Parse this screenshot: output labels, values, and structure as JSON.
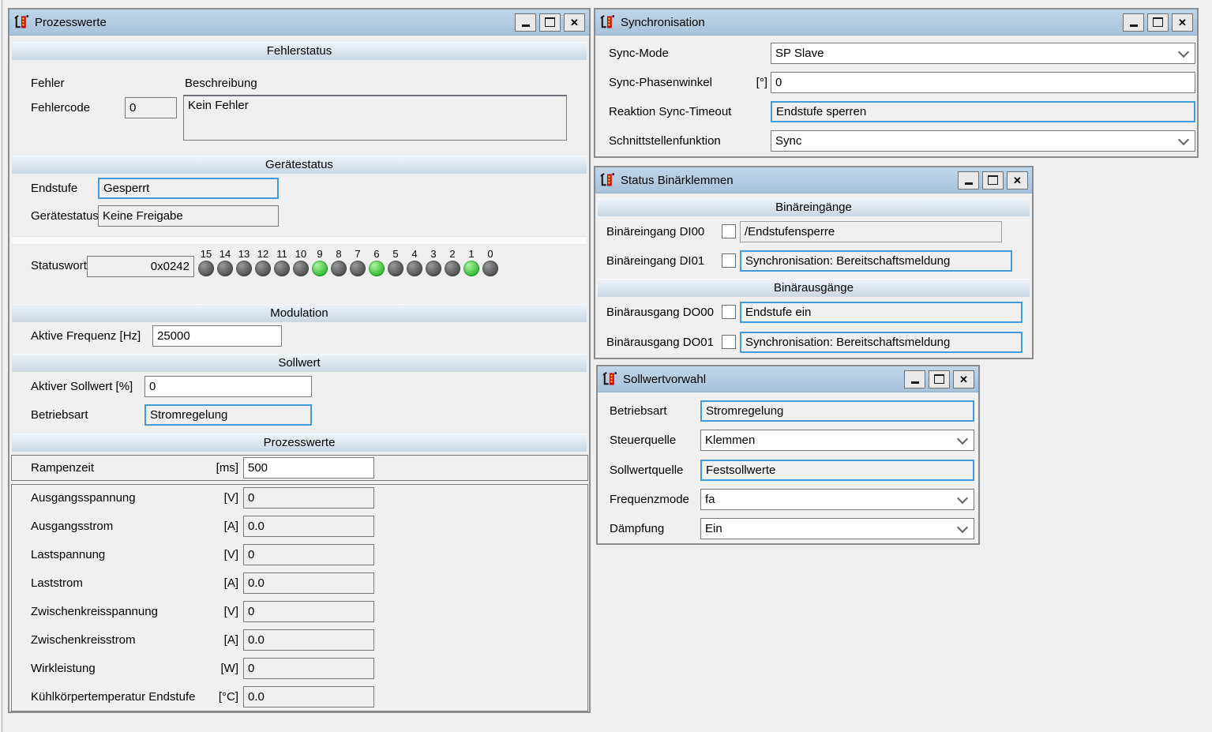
{
  "colors": {
    "titlebar_top": "#c0d6e9",
    "titlebar_bottom": "#a6c2da",
    "section_header_top": "#eef3f8",
    "section_header_bottom": "#c9d7e4",
    "field_border": "#7a7a7a",
    "accent_border": "#3f9bdc",
    "led_on": "#2fb52f",
    "led_off": "#4d4d4d",
    "window_bg": "#f0f0f0"
  },
  "prozesswerte": {
    "title": "Prozesswerte",
    "fehlerstatus": {
      "header": "Fehlerstatus",
      "fehler_label": "Fehler",
      "beschreibung_label": "Beschreibung",
      "fehlercode_label": "Fehlercode",
      "fehlercode_value": "0",
      "beschreibung_value": "Kein Fehler"
    },
    "geraetestatus": {
      "header": "Gerätestatus",
      "endstufe_label": "Endstufe",
      "endstufe_value": "Gesperrt",
      "status_label": "Gerätestatus",
      "status_value": "Keine Freigabe",
      "statuswort_label": "Statuswort",
      "statuswort_value": "0x0242",
      "led_bits": [
        {
          "bit": "15",
          "on": false
        },
        {
          "bit": "14",
          "on": false
        },
        {
          "bit": "13",
          "on": false
        },
        {
          "bit": "12",
          "on": false
        },
        {
          "bit": "11",
          "on": false
        },
        {
          "bit": "10",
          "on": false
        },
        {
          "bit": "9",
          "on": true
        },
        {
          "bit": "8",
          "on": false
        },
        {
          "bit": "7",
          "on": false
        },
        {
          "bit": "6",
          "on": true
        },
        {
          "bit": "5",
          "on": false
        },
        {
          "bit": "4",
          "on": false
        },
        {
          "bit": "3",
          "on": false
        },
        {
          "bit": "2",
          "on": false
        },
        {
          "bit": "1",
          "on": true
        },
        {
          "bit": "0",
          "on": false
        }
      ]
    },
    "modulation": {
      "header": "Modulation",
      "frequenz_label": "Aktive Frequenz  [Hz]",
      "frequenz_value": "25000"
    },
    "sollwert": {
      "header": "Sollwert",
      "aktiver_label": "Aktiver Sollwert [%]",
      "aktiver_value": "0",
      "betriebsart_label": "Betriebsart",
      "betriebsart_value": "Stromregelung"
    },
    "werte": {
      "header": "Prozesswerte",
      "rampenzeit": {
        "label": "Rampenzeit",
        "unit": "[ms]",
        "value": "500"
      },
      "rows": [
        {
          "label": "Ausgangsspannung",
          "unit": "[V]",
          "value": "0"
        },
        {
          "label": "Ausgangsstrom",
          "unit": "[A]",
          "value": "0.0"
        },
        {
          "label": "Lastspannung",
          "unit": "[V]",
          "value": "0"
        },
        {
          "label": "Laststrom",
          "unit": "[A]",
          "value": "0.0"
        },
        {
          "label": "Zwischenkreisspannung",
          "unit": "[V]",
          "value": "0"
        },
        {
          "label": "Zwischenkreisstrom",
          "unit": "[A]",
          "value": "0.0"
        },
        {
          "label": "Wirkleistung",
          "unit": "[W]",
          "value": "0"
        },
        {
          "label": "Kühlkörpertemperatur Endstufe",
          "unit": "[°C]",
          "value": "0.0"
        }
      ]
    }
  },
  "synchronisation": {
    "title": "Synchronisation",
    "sync_mode": {
      "label": "Sync-Mode",
      "value": "SP Slave"
    },
    "phasenwinkel": {
      "label": "Sync-Phasenwinkel",
      "unit": "[°]",
      "value": "0"
    },
    "timeout": {
      "label": "Reaktion Sync-Timeout",
      "value": "Endstufe sperren"
    },
    "schnittstelle": {
      "label": "Schnittstellenfunktion",
      "value": "Sync"
    }
  },
  "binaerklemmen": {
    "title": "Status Binärklemmen",
    "eingaenge_header": "Binäreingänge",
    "ausgaenge_header": "Binärausgänge",
    "di00": {
      "label": "Binäreingang DI00",
      "value": "/Endstufensperre"
    },
    "di01": {
      "label": "Binäreingang DI01",
      "value": "Synchronisation: Bereitschaftsmeldung"
    },
    "do00": {
      "label": "Binärausgang DO00",
      "value": "Endstufe ein"
    },
    "do01": {
      "label": "Binärausgang DO01",
      "value": "Synchronisation: Bereitschaftsmeldung"
    }
  },
  "sollwertvorwahl": {
    "title": "Sollwertvorwahl",
    "betriebsart": {
      "label": "Betriebsart",
      "value": "Stromregelung"
    },
    "steuerquelle": {
      "label": "Steuerquelle",
      "value": "Klemmen"
    },
    "sollwertquelle": {
      "label": "Sollwertquelle",
      "value": "Festsollwerte"
    },
    "frequenzmode": {
      "label": "Frequenzmode",
      "value": "fa"
    },
    "daempfung": {
      "label": "Dämpfung",
      "value": "Ein"
    }
  }
}
